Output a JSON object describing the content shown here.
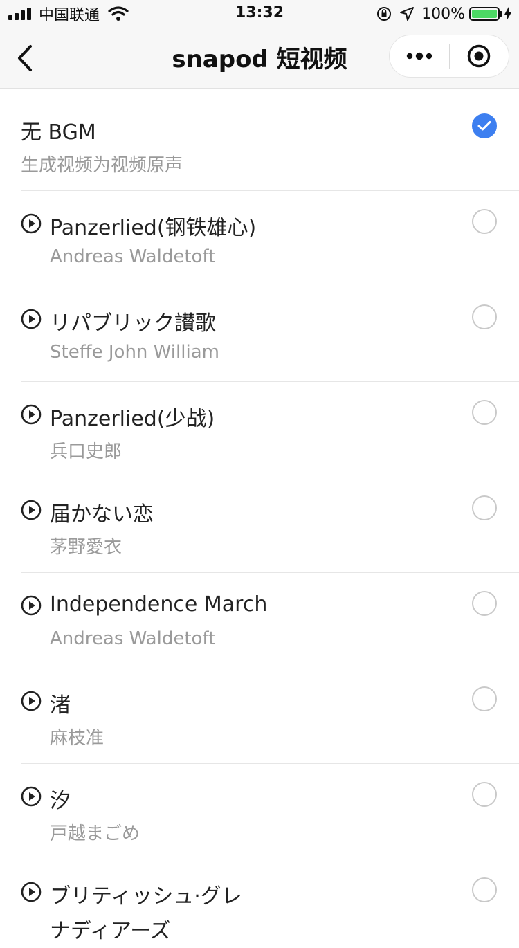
{
  "status_bar": {
    "carrier": "中国联通",
    "time": "13:32",
    "battery_pct": "100%",
    "battery_level": 1.0
  },
  "nav": {
    "title": "snapod 短视频"
  },
  "colors": {
    "accent": "#3d7ff0",
    "battery": "#4cd964"
  },
  "bgm_list": [
    {
      "title": "无 BGM",
      "subtitle": "生成视频为视频原声",
      "selected": true
    },
    {
      "title": "Panzerlied(钢铁雄心)",
      "subtitle": "Andreas Waldetoft",
      "selected": false
    },
    {
      "title": "リパブリック讃歌",
      "subtitle": "Steffe John William",
      "selected": false
    },
    {
      "title": "Panzerlied(少战)",
      "subtitle": "兵口史郎",
      "selected": false
    },
    {
      "title": "届かない恋",
      "subtitle": "茅野愛衣",
      "selected": false
    },
    {
      "title": "Independence March",
      "subtitle": "Andreas Waldetoft",
      "selected": false
    },
    {
      "title": "渚",
      "subtitle": "麻枝准",
      "selected": false
    },
    {
      "title": "汐",
      "subtitle": "戸越まごめ",
      "selected": false
    },
    {
      "title": "ブリティッシュ·グレ",
      "title_line2": "ナディアーズ",
      "selected": false
    }
  ]
}
